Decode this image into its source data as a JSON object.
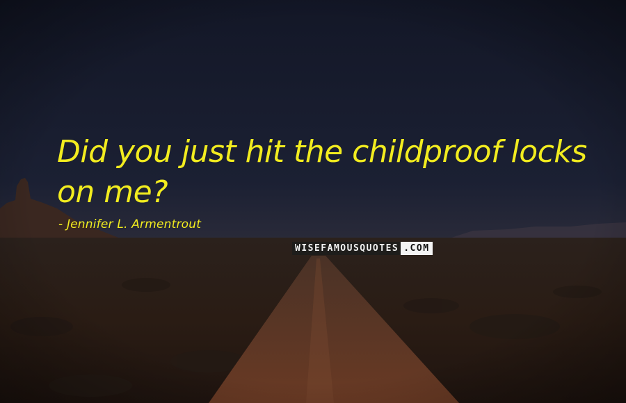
{
  "quote": {
    "text": "Did you just hit the childproof locks on me?",
    "author": "- Jennifer L. Armentrout"
  },
  "watermark": {
    "main": "WISEFAMOUSQUOTES",
    "tld": ".COM"
  },
  "colors": {
    "quote_text": "#f2ec1f",
    "sky_top": "#141828",
    "ground": "#2a1d16",
    "road": "#5a3423"
  }
}
